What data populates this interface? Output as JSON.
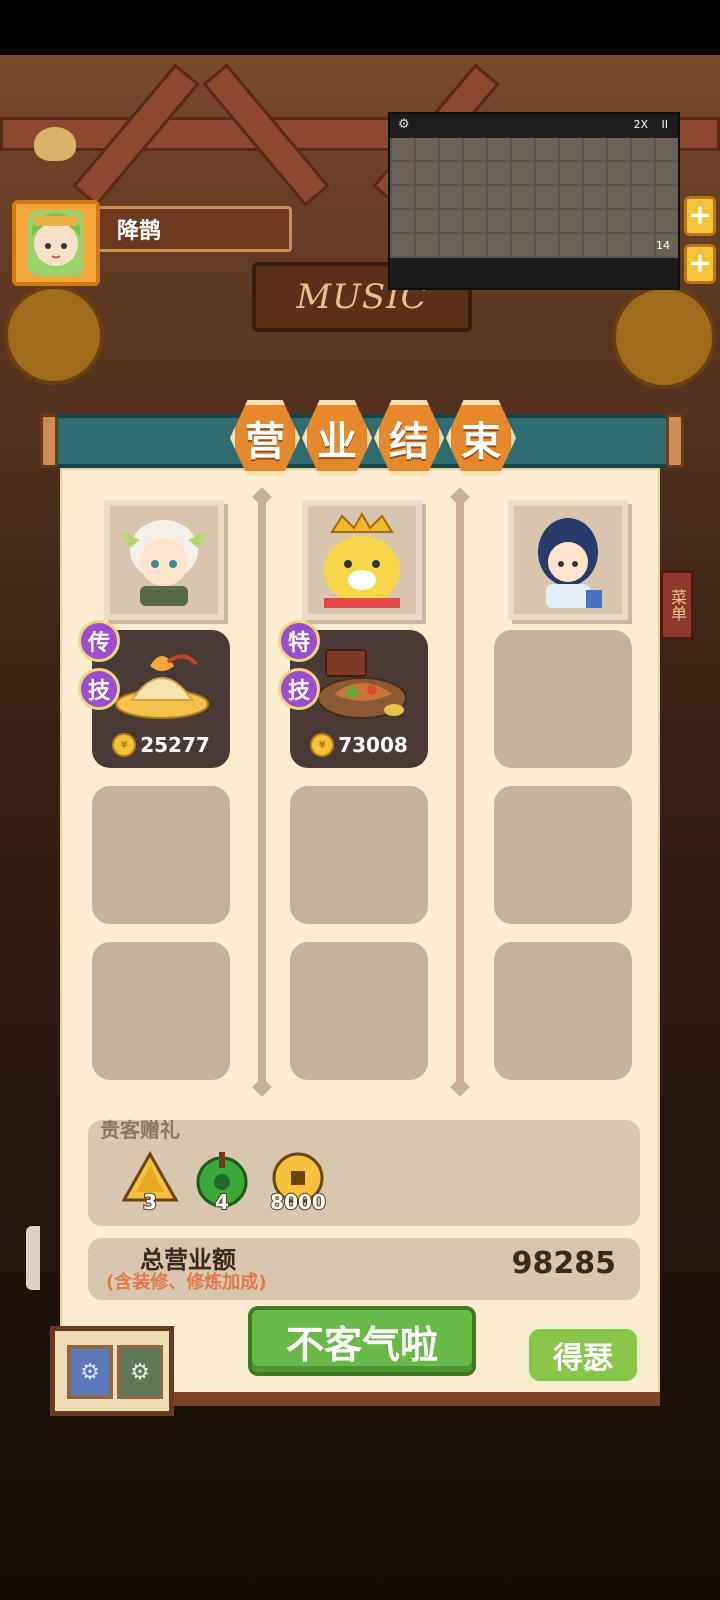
{
  "player": {
    "name": "降鹊",
    "avatar_icon": "green-haired-girl-avatar"
  },
  "background": {
    "sign_text": "MUSIC",
    "side_sign_text": "菜单"
  },
  "video_overlay": {
    "speed_label": "2X",
    "pause_label": "II",
    "counter": "14"
  },
  "title": {
    "chars": [
      "营",
      "业",
      "结",
      "束"
    ]
  },
  "columns": [
    {
      "portrait_icon": "white-haired-girl-portrait",
      "slots": [
        {
          "filled": true,
          "badges": [
            "传",
            "技"
          ],
          "dish_icon": "noodle-dish-icon",
          "price": "25277"
        },
        {
          "filled": false
        },
        {
          "filled": false
        }
      ]
    },
    {
      "portrait_icon": "crowned-chick-portrait",
      "slots": [
        {
          "filled": true,
          "badges": [
            "特",
            "技"
          ],
          "dish_icon": "grilled-platter-icon",
          "price": "73008"
        },
        {
          "filled": false
        },
        {
          "filled": false
        }
      ]
    },
    {
      "portrait_icon": "blue-haired-woman-portrait",
      "slots": [
        {
          "filled": false
        },
        {
          "filled": false
        },
        {
          "filled": false
        }
      ]
    }
  ],
  "gifts": {
    "title": "贵客赠礼",
    "items": [
      {
        "icon": "rice-dumpling-icon",
        "count": "3"
      },
      {
        "icon": "jade-token-icon",
        "count": "4"
      },
      {
        "icon": "gold-coin-icon",
        "count": "8000"
      }
    ]
  },
  "total": {
    "label": "总营业额",
    "sublabel": "(含装修、修炼加成)",
    "value": "98285"
  },
  "buttons": {
    "confirm": "不客气啦",
    "secondary": "得瑟"
  },
  "colors": {
    "panel": "#fbecd0",
    "banner": "#2e6e72",
    "title_hex": "#e6892d",
    "confirm_button": "#69b948",
    "slot_empty": "#c3b39d"
  }
}
